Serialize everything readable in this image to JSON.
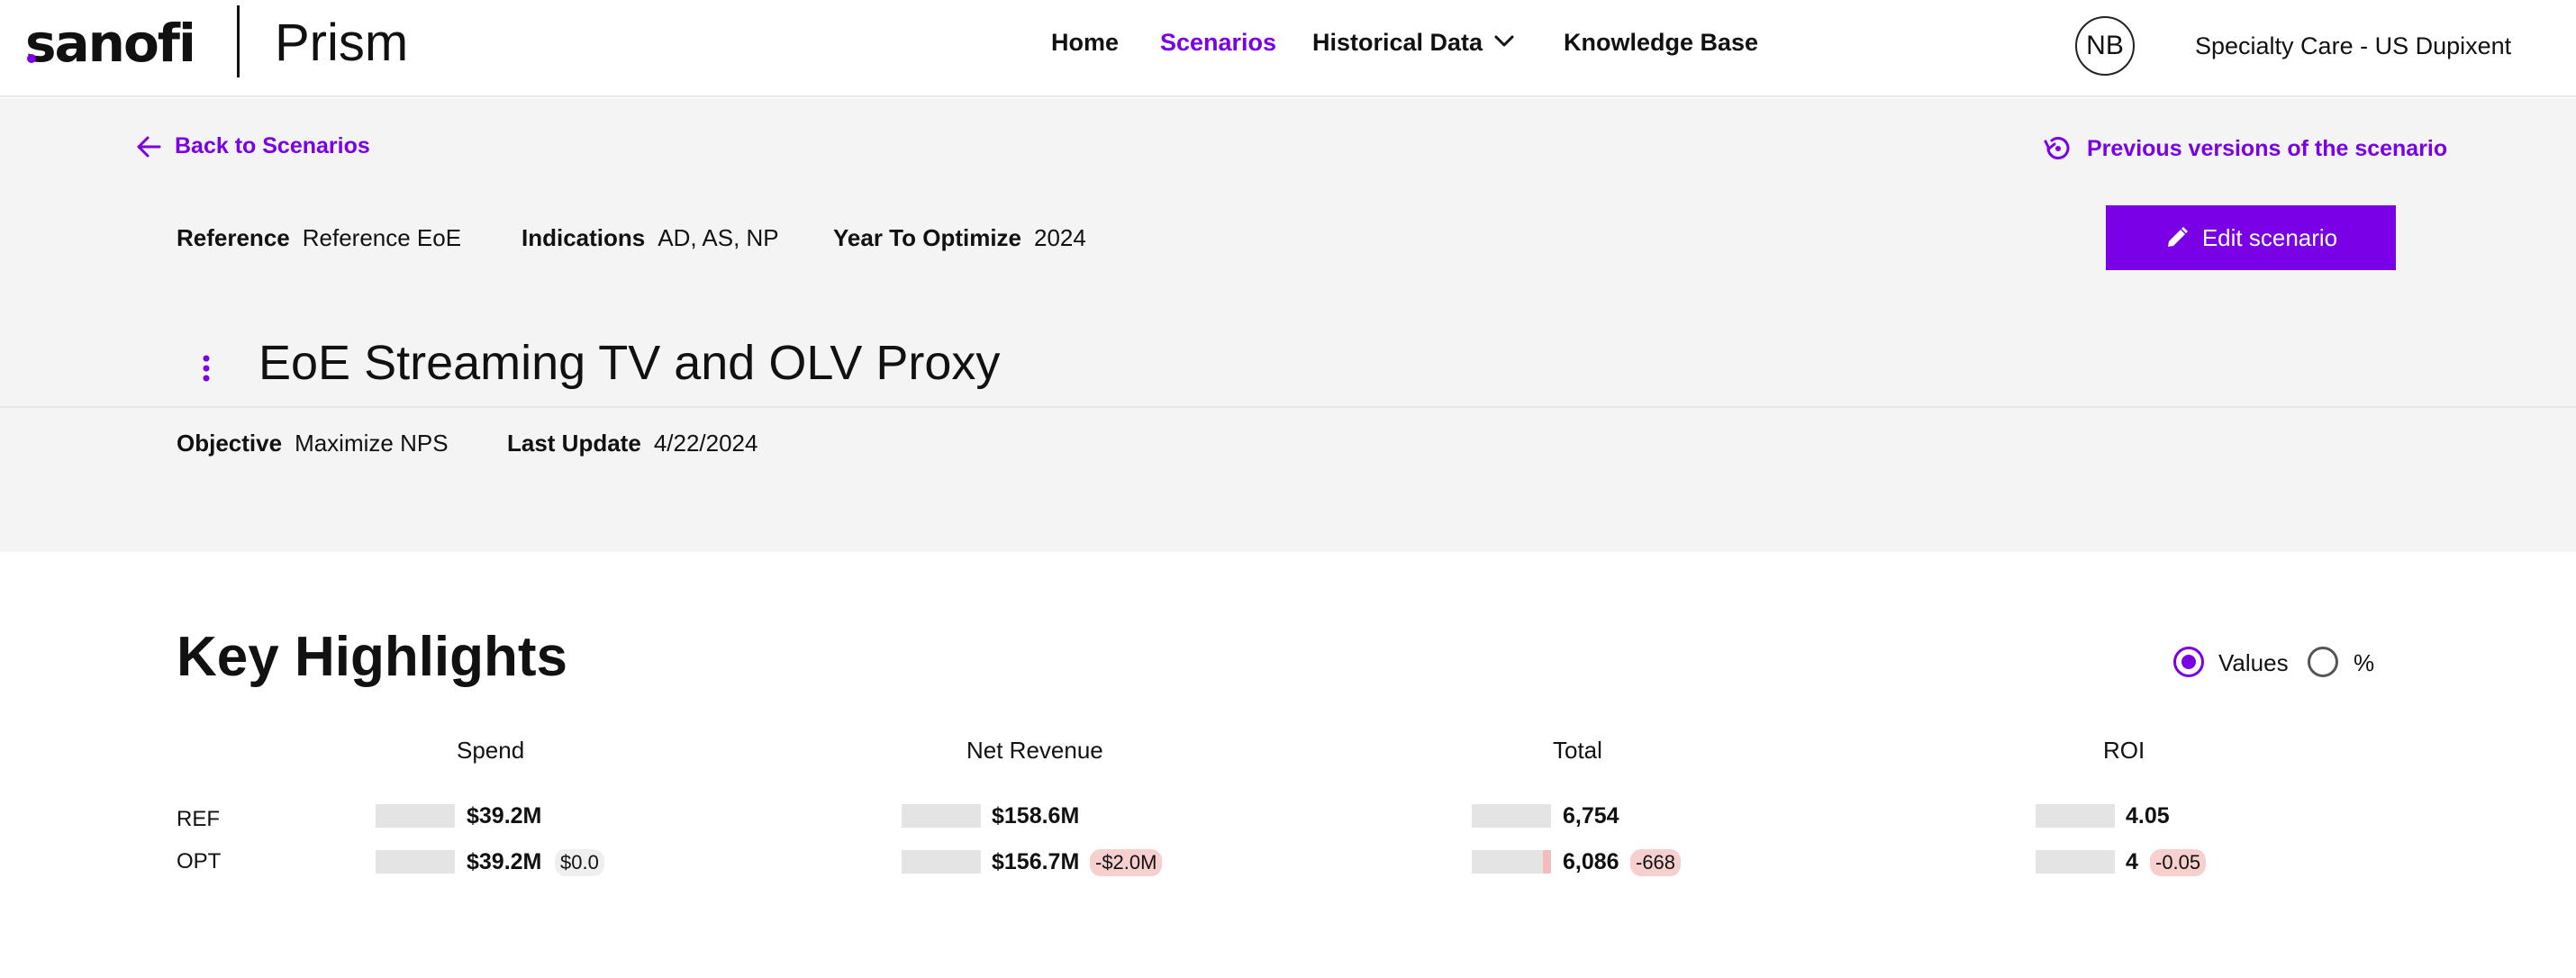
{
  "brand": {
    "logo": "sanofi",
    "product": "Prism",
    "accent": "#7a00e6"
  },
  "nav": {
    "home": "Home",
    "scenarios": "Scenarios",
    "historical": "Historical Data",
    "knowledge": "Knowledge Base",
    "active": "Scenarios"
  },
  "user": {
    "initials": "NB",
    "tenant": "Specialty Care - US Dupixent"
  },
  "header": {
    "back_label": "Back to Scenarios",
    "previous_versions_label": "Previous versions of the scenario",
    "reference_label": "Reference",
    "reference_value": "Reference EoE",
    "indications_label": "Indications",
    "indications_value": "AD, AS, NP",
    "year_label": "Year To Optimize",
    "year_value": "2024",
    "edit_label": "Edit scenario"
  },
  "scenario": {
    "title": "EoE Streaming TV and OLV Proxy",
    "objective_label": "Objective",
    "objective_value": "Maximize NPS",
    "update_label": "Last Update",
    "update_value": "4/22/2024"
  },
  "highlights": {
    "title": "Key Highlights",
    "mode_options": [
      "Values",
      "%"
    ],
    "mode_selected": "Values",
    "row_labels": [
      "REF",
      "OPT"
    ],
    "metrics": [
      {
        "name": "Spend",
        "ref": "$39.2M",
        "opt": "$39.2M",
        "delta": "$0.0",
        "delta_type": "neutral",
        "opt_fill": 0
      },
      {
        "name": "Net Revenue",
        "ref": "$158.6M",
        "opt": "$156.7M",
        "delta": "-$2.0M",
        "delta_type": "neg",
        "opt_fill": 0
      },
      {
        "name": "Total",
        "ref": "6,754",
        "opt": "6,086",
        "delta": "-668",
        "delta_type": "neg",
        "opt_fill": 0.099
      },
      {
        "name": "ROI",
        "ref": "4.05",
        "opt": "4",
        "delta": "-0.05",
        "delta_type": "neg",
        "opt_fill": 0
      }
    ]
  }
}
